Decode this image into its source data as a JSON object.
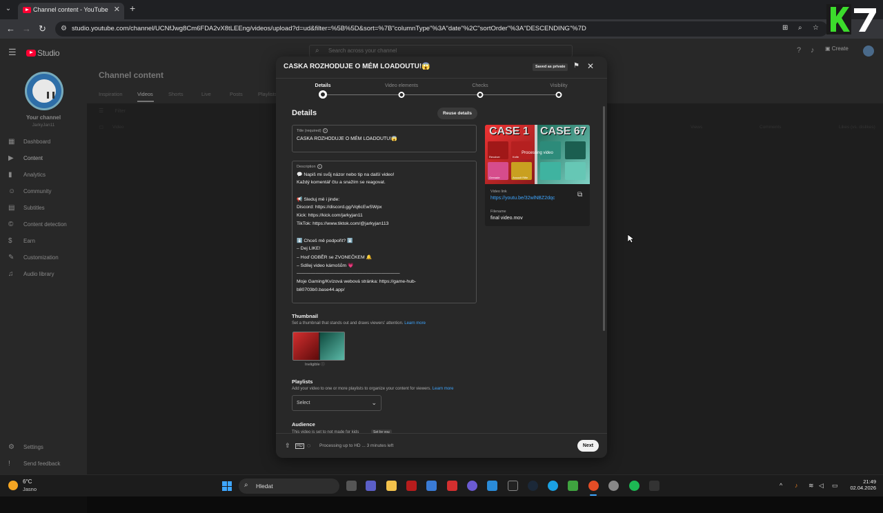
{
  "browser": {
    "tab_title": "Channel content - YouTube Studio",
    "url": "studio.youtube.com/channel/UCNfJwg8Cm6FDA2vX8tLEEng/videos/upload?d=ud&filter=%5B%5D&sort=%7B\"columnType\"%3A\"date\"%2C\"sortOrder\"%3A\"DESCENDING\"%7D"
  },
  "studio": {
    "logo_text": "Studio",
    "search_placeholder": "Search across your channel",
    "create_label": "Create",
    "page_title": "Channel content",
    "tabs": [
      "Inspiration",
      "Videos",
      "Shorts",
      "Live",
      "Posts",
      "Playlists"
    ],
    "active_tab": "Videos",
    "filter_label": "Filter",
    "columns": [
      "Video",
      "Views",
      "Comments",
      "Likes (vs. dislikes)"
    ],
    "channel": {
      "title": "Your channel",
      "handle": "JarkyJan11"
    },
    "sidebar": [
      {
        "icon": "dashboard-icon",
        "glyph": "▦",
        "label": "Dashboard"
      },
      {
        "icon": "content-icon",
        "glyph": "▶",
        "label": "Content"
      },
      {
        "icon": "analytics-icon",
        "glyph": "▮",
        "label": "Analytics"
      },
      {
        "icon": "community-icon",
        "glyph": "☺",
        "label": "Community"
      },
      {
        "icon": "subtitles-icon",
        "glyph": "▤",
        "label": "Subtitles"
      },
      {
        "icon": "copyright-icon",
        "glyph": "©",
        "label": "Content detection"
      },
      {
        "icon": "earn-icon",
        "glyph": "$",
        "label": "Earn"
      },
      {
        "icon": "customization-icon",
        "glyph": "✎",
        "label": "Customization"
      },
      {
        "icon": "audio-library-icon",
        "glyph": "♫",
        "label": "Audio library"
      }
    ],
    "sidebar_bottom": [
      {
        "icon": "settings-icon",
        "glyph": "⚙",
        "label": "Settings"
      },
      {
        "icon": "feedback-icon",
        "glyph": "!",
        "label": "Send feedback"
      }
    ]
  },
  "dialog": {
    "title": "CASKA ROZHODUJE O MÉM LOADOUTU!😱",
    "saved_badge": "Saved as private",
    "steps": [
      "Details",
      "Video elements",
      "Checks",
      "Visibility"
    ],
    "current_step": "Details",
    "section_title": "Details",
    "reuse_label": "Reuse details",
    "title_field": {
      "label": "Title (required)",
      "value": "CASKA ROZHODUJE O MÉM LOADOUTU!😱"
    },
    "description_field": {
      "label": "Description",
      "lines": [
        "💬 Napiš mi svůj názor nebo tip na další video!",
        "Každý komentář čtu a snažím se reagovat.",
        "",
        "📢 Sleduj mě i jinde:",
        "Discord: https://discord.gg/Vq6cEwSWpx",
        "Kick: https://kick.com/jarkyjan11",
        "TikTok: https://www.tiktok.com/@jarkyjan113",
        "",
        "⬇️ Chceš mě podpořit? ⬇️",
        "– Dej LIKE!",
        "– Hoď ODBĚR se ZVONEČKEM 🔔",
        "– Sdílej video kámošům 💗",
        "——————————————————————",
        "Moje Gaming/Kvízová webová stránka: https://game-hub-",
        "b80703b0.base44.app/"
      ]
    },
    "preview": {
      "case_left": "CASE 1",
      "case_right": "CASE 67",
      "processing_text": "Processing video",
      "tiles_left": [
        "Revolver",
        "Knife",
        "Grenade",
        "Assault Rifle"
      ],
      "video_link_label": "Video link",
      "video_link": "https://youtu.be/32wlNBZ2dqc",
      "filename_label": "Filename",
      "filename": "final video.mov"
    },
    "thumbnail": {
      "title": "Thumbnail",
      "subtitle": "Set a thumbnail that stands out and draws viewers' attention.",
      "learn_more": "Learn more",
      "caption": "Ineligible"
    },
    "playlists": {
      "title": "Playlists",
      "subtitle": "Add your video to one or more playlists to organize your content for viewers.",
      "learn_more": "Learn more",
      "select_value": "Select"
    },
    "audience": {
      "title": "Audience",
      "subtitle": "This video is set to not made for kids",
      "badge": "Set by you"
    },
    "footer": {
      "status": "Processing up to HD ... 3 minutes left",
      "next_label": "Next"
    }
  },
  "taskbar": {
    "temperature": "6°C",
    "weather": "Jasno",
    "search_label": "Hledat",
    "time": "21:49",
    "date": "02.04.2026"
  }
}
